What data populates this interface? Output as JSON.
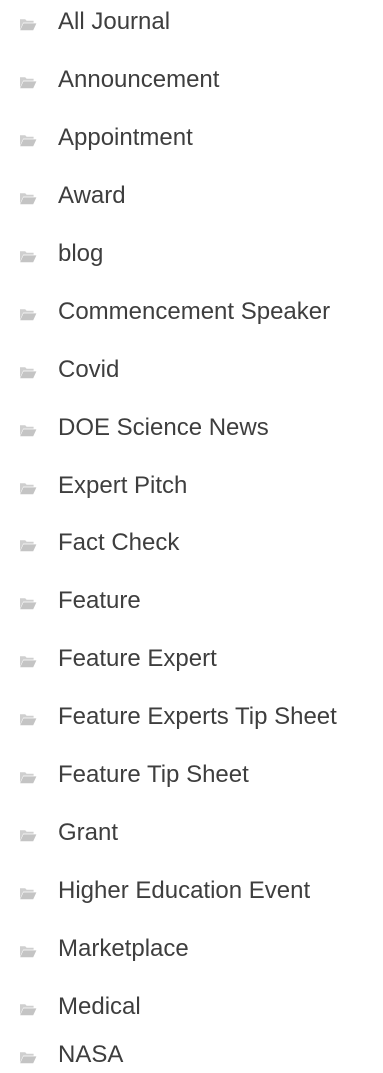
{
  "categories": {
    "items": [
      {
        "label": "All Journal",
        "icon": "folder-open-icon"
      },
      {
        "label": "Announcement",
        "icon": "folder-open-icon"
      },
      {
        "label": "Appointment",
        "icon": "folder-open-icon"
      },
      {
        "label": "Award",
        "icon": "folder-open-icon"
      },
      {
        "label": "blog",
        "icon": "folder-open-icon"
      },
      {
        "label": "Commencement Speaker",
        "icon": "folder-open-icon"
      },
      {
        "label": "Covid",
        "icon": "folder-open-icon"
      },
      {
        "label": "DOE Science News",
        "icon": "folder-open-icon"
      },
      {
        "label": "Expert Pitch",
        "icon": "folder-open-icon"
      },
      {
        "label": "Fact Check",
        "icon": "folder-open-icon"
      },
      {
        "label": "Feature",
        "icon": "folder-open-icon"
      },
      {
        "label": "Feature Expert",
        "icon": "folder-open-icon"
      },
      {
        "label": "Feature Experts Tip Sheet",
        "icon": "folder-open-icon"
      },
      {
        "label": "Feature Tip Sheet",
        "icon": "folder-open-icon"
      },
      {
        "label": "Grant",
        "icon": "folder-open-icon"
      },
      {
        "label": "Higher Education Event",
        "icon": "folder-open-icon"
      },
      {
        "label": "Marketplace",
        "icon": "folder-open-icon"
      },
      {
        "label": "Medical",
        "icon": "folder-open-icon"
      },
      {
        "label": "NASA",
        "icon": "folder-open-icon"
      }
    ]
  },
  "colors": {
    "text": "#3e3e3e",
    "icon": "#c4c4c4",
    "background": "#ffffff"
  }
}
